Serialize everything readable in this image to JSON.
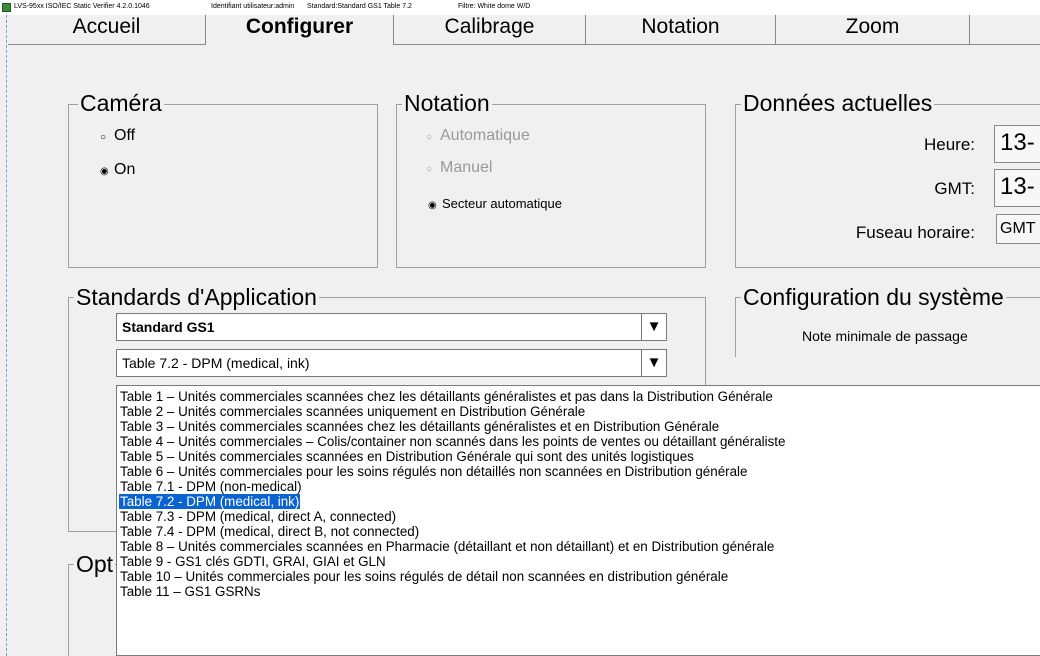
{
  "window": {
    "title_parts": [
      "LVS-95xx ISO/IEC Static Verifier 4.2.0.1046",
      "Identifiant utilisateur:admin",
      "Standard:Standard GS1 Table 7.2",
      "Filtre: White dome W/D"
    ]
  },
  "tabs": [
    {
      "label": "Accueil",
      "active": false
    },
    {
      "label": "Configurer",
      "active": true
    },
    {
      "label": "Calibrage",
      "active": false
    },
    {
      "label": "Notation",
      "active": false
    },
    {
      "label": "Zoom",
      "active": false
    },
    {
      "label": "",
      "active": false
    }
  ],
  "camera": {
    "title": "Caméra",
    "options": [
      {
        "label": "Off",
        "selected": false
      },
      {
        "label": "On",
        "selected": true
      }
    ]
  },
  "notation": {
    "title": "Notation",
    "options": [
      {
        "label": "Automatique",
        "selected": false,
        "enabled": false
      },
      {
        "label": "Manuel",
        "selected": false,
        "enabled": false
      },
      {
        "label": "Secteur automatique",
        "selected": true,
        "enabled": true
      }
    ]
  },
  "current_data": {
    "title": "Données actuelles",
    "fields": [
      {
        "label": "Heure:",
        "value": "13-"
      },
      {
        "label": "GMT:",
        "value": "13-"
      },
      {
        "label": "Fuseau horaire:",
        "value": "GMT"
      }
    ]
  },
  "application_standards": {
    "title": "Standards d'Application",
    "standard_value": "Standard GS1",
    "table_value": "Table 7.2 - DPM (medical, ink)",
    "arrow_glyph": "▼"
  },
  "system_config": {
    "title": "Configuration du système",
    "min_grade_label": "Note minimale de passage"
  },
  "options_group": {
    "title": "Opt"
  },
  "dropdown": {
    "items": [
      "Table 1 – Unités commerciales scannées chez les détaillants généralistes et pas dans la Distribution Générale",
      "Table 2 – Unités commerciales scannées uniquement en Distribution Générale",
      "Table 3 – Unités commerciales scannées chez les détaillants généralistes et en Distribution Générale",
      "Table  4 – Unités commerciales – Colis/container non scannés dans les points de ventes ou détaillant généraliste",
      "Table 5 – Unités commerciales scannées en Distribution Générale qui sont des unités logistiques",
      "Table 6 – Unités commerciales pour les soins régulés non détaillés  non scannées en Distribution générale",
      "Table 7.1 - DPM (non-medical)",
      "Table 7.2 - DPM (medical, ink)",
      "Table 7.3 - DPM (medical, direct A, connected)",
      "Table 7.4 - DPM (medical, direct B, not connected)",
      "Table 8 – Unités commerciales scannées en Pharmacie (détaillant et non détaillant) et en Distribution générale",
      "Table 9 - GS1 clés GDTI, GRAI, GIAI et GLN",
      "Table 10 – Unités commerciales pour les soins régulés de détail non scannées en distribution générale",
      "Table  11 – GS1 GSRNs"
    ],
    "selected_index": 7
  },
  "colors": {
    "selection": "#0a63d0",
    "background": "#f0f0f0",
    "disabled_text": "#9a9a9a"
  }
}
